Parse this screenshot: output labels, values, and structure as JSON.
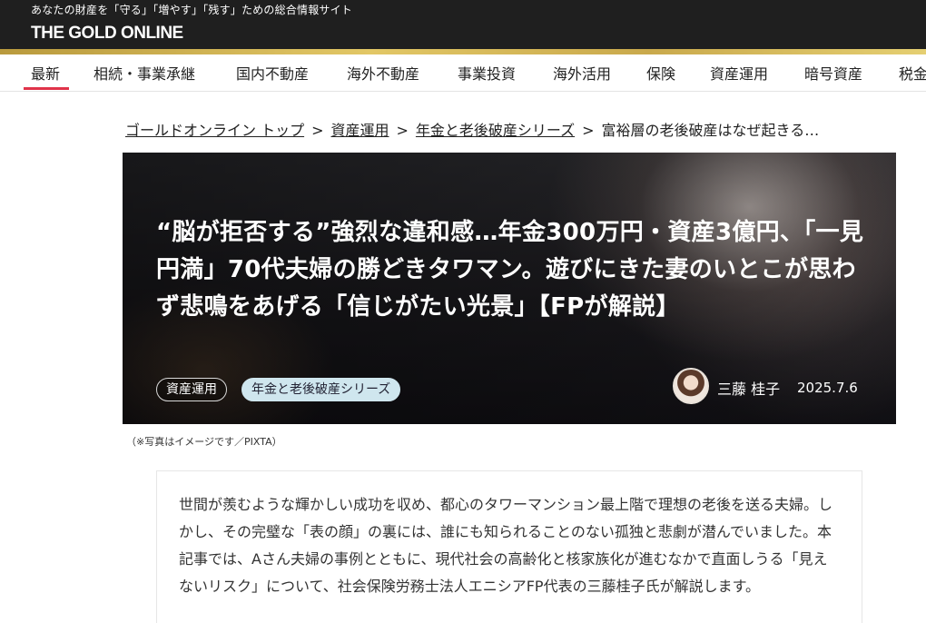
{
  "header": {
    "tagline": "あなたの財産を「守る」「増やす」「残す」ための総合情報サイト",
    "logo": "THE GOLD ONLINE"
  },
  "nav": {
    "items": [
      "最新",
      "相続・事業承継",
      "国内不動産",
      "海外不動産",
      "事業投資",
      "海外活用",
      "保険",
      "資産運用",
      "暗号資産",
      "税金"
    ],
    "active_index": 0
  },
  "breadcrumb": {
    "items": [
      "ゴールドオンライン トップ",
      "資産運用",
      "年金と老後破産シリーズ"
    ],
    "separator": ">",
    "current": "富裕層の老後破産はなぜ起きる…"
  },
  "article": {
    "title": "“脳が拒否する”強烈な違和感…年金300万円・資産3億円、「一見円満」70代夫婦の勝どきタワマン。遊びにきた妻のいとこが思わず悲鳴をあげる「信じがたい光景」【FPが解説】",
    "tags": [
      "資産運用",
      "年金と老後破産シリーズ"
    ],
    "author": "三藤 桂子",
    "date": "2025.7.6",
    "photo_credit": "（※写真はイメージです／PIXTA）",
    "lead": "世間が羨むような輝かしい成功を収め、都心のタワーマンション最上階で理想の老後を送る夫婦。しかし、その完璧な「表の顔」の裏には、誰にも知られることのない孤独と悲劇が潜んでいました。本記事では、Aさん夫婦の事例とともに、現代社会の高齢化と核家族化が進むなかで直面しうる「見えないリスク」について、社会保険労務士法人エニシアFP代表の三藤桂子氏が解説します。"
  },
  "colors": {
    "header_bg": "#1f1f1f",
    "gold_accent": "#d4b655",
    "active_underline": "#e0334a",
    "tag_secondary_bg": "#cfe6ee"
  }
}
